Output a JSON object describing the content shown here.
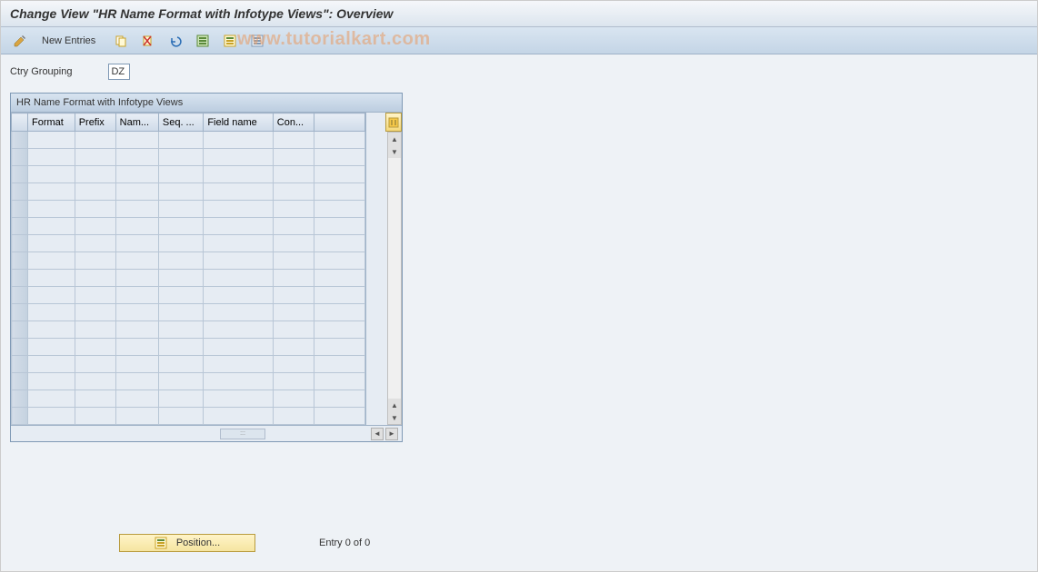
{
  "title": "Change View \"HR Name Format with Infotype Views\": Overview",
  "toolbar": {
    "new_entries_label": "New Entries",
    "icons": [
      "pencil-icon",
      "copy-icon",
      "delete-icon",
      "undo-icon",
      "select-all-icon",
      "select-block-icon",
      "deselect-icon"
    ]
  },
  "watermark": "www.tutorialkart.com",
  "fields": {
    "ctry_grouping_label": "Ctry Grouping",
    "ctry_grouping_value": "DZ"
  },
  "table": {
    "title": "HR Name Format with Infotype Views",
    "columns": [
      "Format",
      "Prefix",
      "Nam...",
      "Seq. ...",
      "Field name",
      "Con..."
    ],
    "row_count": 17
  },
  "footer": {
    "position_label": "Position...",
    "entry_text": "Entry 0 of 0"
  }
}
